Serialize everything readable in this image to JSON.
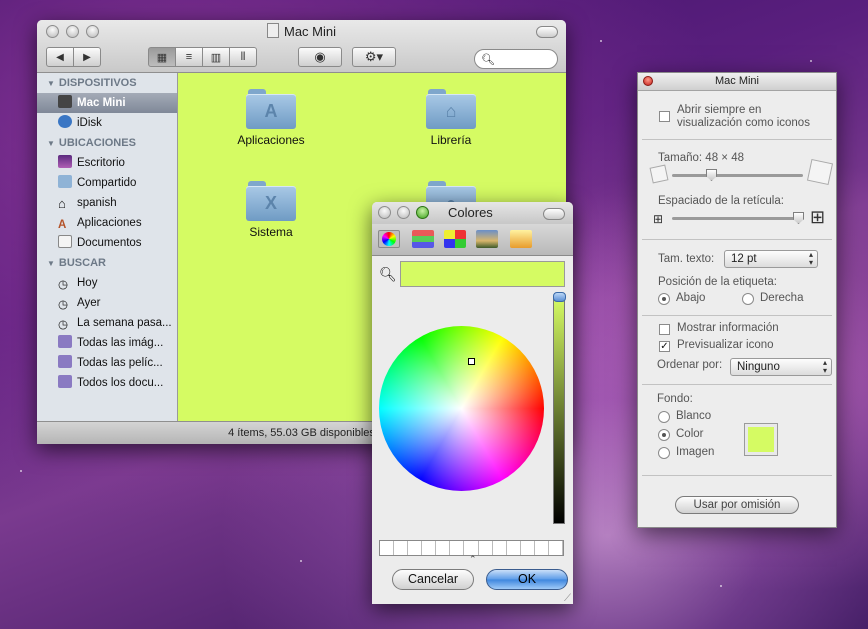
{
  "finder": {
    "title": "Mac Mini",
    "sidebar": {
      "sections": [
        {
          "heading": "DISPOSITIVOS",
          "items": [
            "Mac Mini",
            "iDisk"
          ]
        },
        {
          "heading": "UBICACIONES",
          "items": [
            "Escritorio",
            "Compartido",
            "spanish",
            "Aplicaciones",
            "Documentos"
          ]
        },
        {
          "heading": "BUSCAR",
          "items": [
            "Hoy",
            "Ayer",
            "La semana pasa...",
            "Todas las imág...",
            "Todas las pelíc...",
            "Todos los docu..."
          ]
        }
      ]
    },
    "folders": [
      "Aplicaciones",
      "Librería",
      "Sistema"
    ],
    "status": "4 ítems, 55.03 GB disponibles",
    "background_color": "#d5fb63"
  },
  "colors_panel": {
    "title": "Colores",
    "current_color": "#d5fb63",
    "cancel_label": "Cancelar",
    "ok_label": "OK"
  },
  "inspector": {
    "title": "Mac Mini",
    "always_open_label": "Abrir siempre en visualización como iconos",
    "size_label": "Tamaño: 48 × 48",
    "grid_spacing_label": "Espaciado de la retícula:",
    "text_size_label": "Tam. texto:",
    "text_size_value": "12 pt",
    "label_position_label": "Posición de la etiqueta:",
    "position_bottom": "Abajo",
    "position_right": "Derecha",
    "show_info_label": "Mostrar información",
    "preview_icon_label": "Previsualizar icono",
    "sort_by_label": "Ordenar por:",
    "sort_by_value": "Ninguno",
    "background_label": "Fondo:",
    "bg_white": "Blanco",
    "bg_color": "Color",
    "bg_image": "Imagen",
    "use_default_label": "Usar por omisión"
  }
}
